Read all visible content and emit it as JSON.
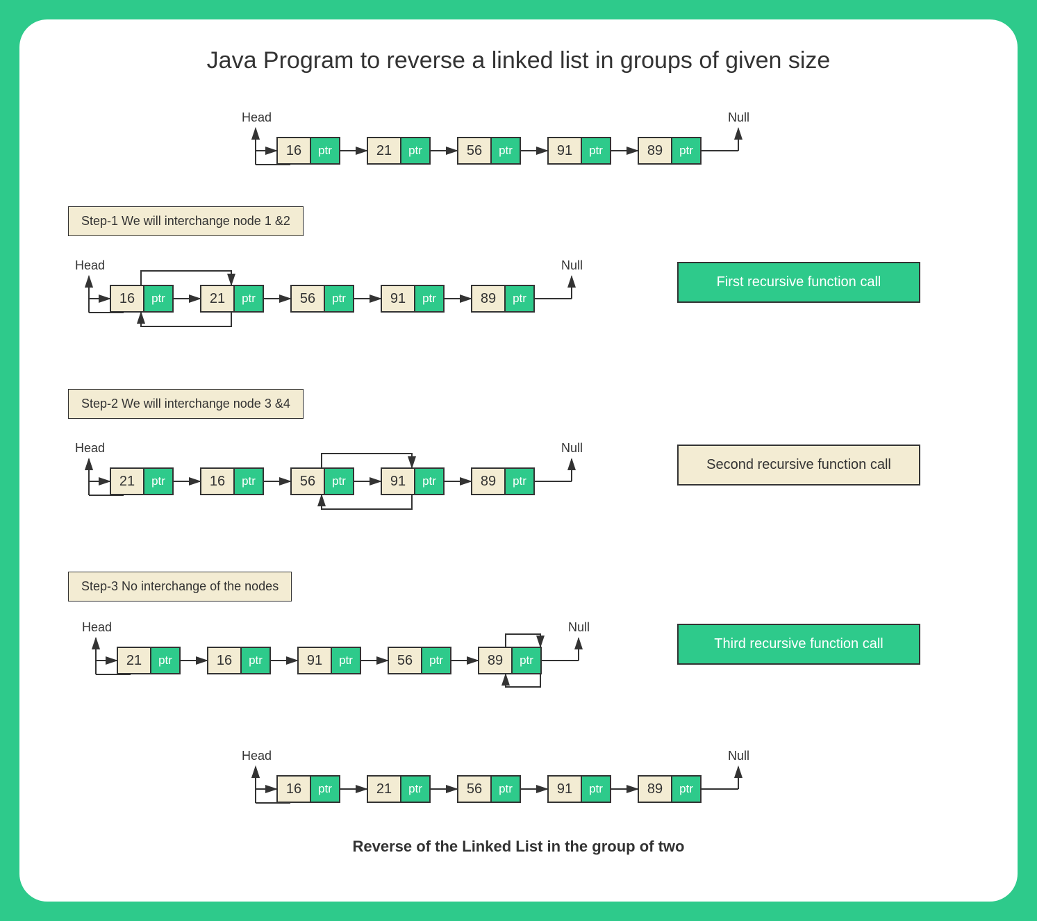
{
  "title": "Java Program to reverse a linked list in groups of given size",
  "labels": {
    "head": "Head",
    "null": "Null",
    "ptr": "ptr"
  },
  "initial_list": [
    "16",
    "21",
    "56",
    "91",
    "89"
  ],
  "steps": [
    {
      "step_label": "Step-1  We will interchange node 1 &2",
      "call_label": "First recursive function call",
      "call_style": "green",
      "nodes": [
        "16",
        "21",
        "56",
        "91",
        "89"
      ],
      "swap_pair": [
        0,
        1
      ]
    },
    {
      "step_label": "Step-2  We will interchange node 3 &4",
      "call_label": "Second recursive function call",
      "call_style": "cream",
      "nodes": [
        "21",
        "16",
        "56",
        "91",
        "89"
      ],
      "swap_pair": [
        2,
        3
      ]
    },
    {
      "step_label": "Step-3  No interchange of the nodes",
      "call_label": "Third recursive function call",
      "call_style": "green",
      "nodes": [
        "21",
        "16",
        "91",
        "56",
        "89"
      ],
      "swap_pair": [
        4,
        4
      ]
    }
  ],
  "final_list": [
    "16",
    "21",
    "56",
    "91",
    "89"
  ],
  "caption": "Reverse of the Linked List in the group of two"
}
